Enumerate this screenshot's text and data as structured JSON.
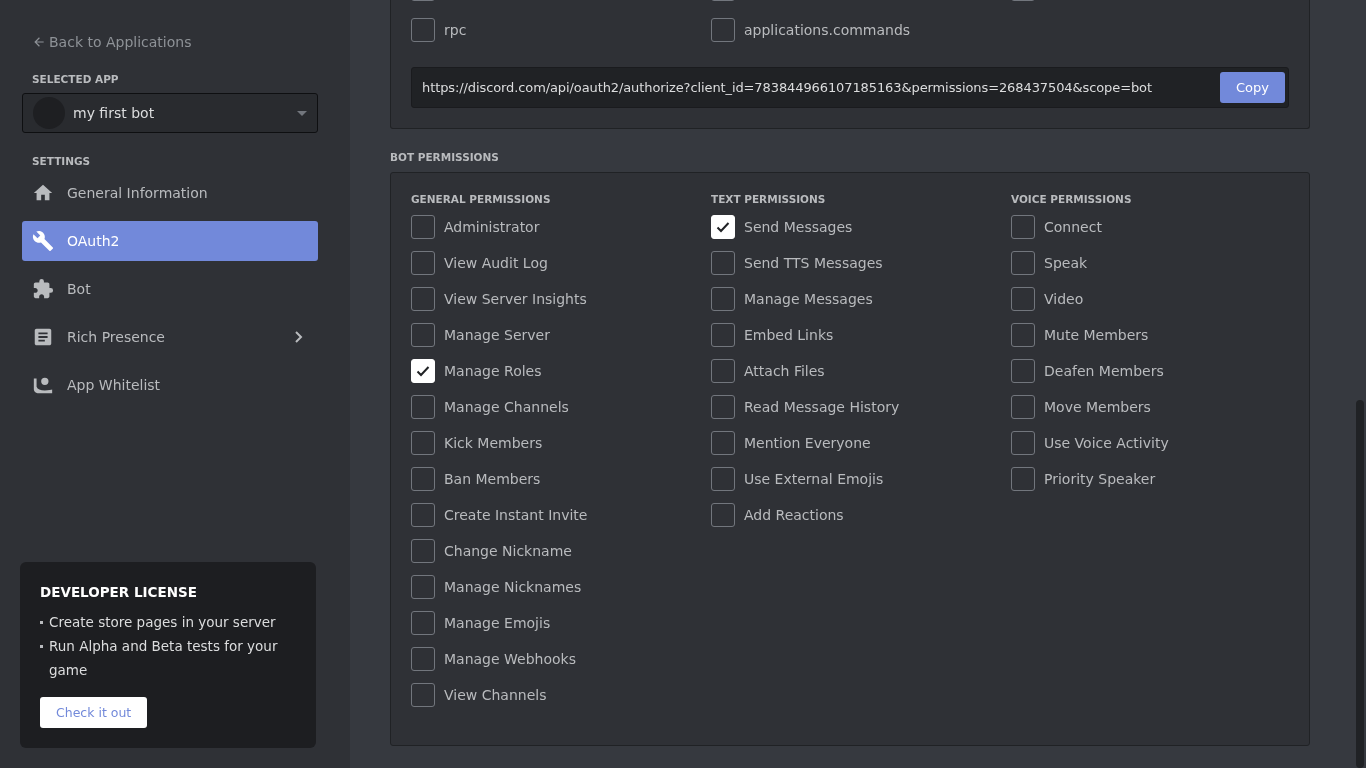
{
  "sidebar": {
    "back_link": "Back to Applications",
    "selected_app_heading": "SELECTED APP",
    "selected_app": "my first bot",
    "settings_heading": "SETTINGS",
    "items": [
      {
        "label": "General Information",
        "selected": false,
        "has_submenu": false
      },
      {
        "label": "OAuth2",
        "selected": true,
        "has_submenu": false
      },
      {
        "label": "Bot",
        "selected": false,
        "has_submenu": false
      },
      {
        "label": "Rich Presence",
        "selected": false,
        "has_submenu": true
      },
      {
        "label": "App Whitelist",
        "selected": false,
        "has_submenu": false
      }
    ],
    "license_card": {
      "title": "DEVELOPER LICENSE",
      "bullets": [
        "Create store pages in your server",
        "Run Alpha and Beta tests for your game"
      ],
      "button": "Check it out"
    }
  },
  "scopes": {
    "cut_row": [
      {
        "checked": false
      },
      {
        "checked": false
      },
      {
        "checked": false
      }
    ],
    "rows": [
      [
        {
          "label": "rpc",
          "checked": false
        },
        {
          "label": "applications.commands",
          "checked": false
        }
      ]
    ],
    "url": "https://discord.com/api/oauth2/authorize?client_id=783844966107185163&permissions=268437504&scope=bot",
    "copy_button": "Copy"
  },
  "bot_permissions": {
    "title": "BOT PERMISSIONS",
    "columns": [
      {
        "heading": "GENERAL PERMISSIONS",
        "items": [
          {
            "label": "Administrator",
            "checked": false
          },
          {
            "label": "View Audit Log",
            "checked": false
          },
          {
            "label": "View Server Insights",
            "checked": false
          },
          {
            "label": "Manage Server",
            "checked": false
          },
          {
            "label": "Manage Roles",
            "checked": true
          },
          {
            "label": "Manage Channels",
            "checked": false
          },
          {
            "label": "Kick Members",
            "checked": false
          },
          {
            "label": "Ban Members",
            "checked": false
          },
          {
            "label": "Create Instant Invite",
            "checked": false
          },
          {
            "label": "Change Nickname",
            "checked": false
          },
          {
            "label": "Manage Nicknames",
            "checked": false
          },
          {
            "label": "Manage Emojis",
            "checked": false
          },
          {
            "label": "Manage Webhooks",
            "checked": false
          },
          {
            "label": "View Channels",
            "checked": false
          }
        ]
      },
      {
        "heading": "TEXT PERMISSIONS",
        "items": [
          {
            "label": "Send Messages",
            "checked": true
          },
          {
            "label": "Send TTS Messages",
            "checked": false
          },
          {
            "label": "Manage Messages",
            "checked": false
          },
          {
            "label": "Embed Links",
            "checked": false
          },
          {
            "label": "Attach Files",
            "checked": false
          },
          {
            "label": "Read Message History",
            "checked": false
          },
          {
            "label": "Mention Everyone",
            "checked": false
          },
          {
            "label": "Use External Emojis",
            "checked": false
          },
          {
            "label": "Add Reactions",
            "checked": false
          }
        ]
      },
      {
        "heading": "VOICE PERMISSIONS",
        "items": [
          {
            "label": "Connect",
            "checked": false
          },
          {
            "label": "Speak",
            "checked": false
          },
          {
            "label": "Video",
            "checked": false
          },
          {
            "label": "Mute Members",
            "checked": false
          },
          {
            "label": "Deafen Members",
            "checked": false
          },
          {
            "label": "Move Members",
            "checked": false
          },
          {
            "label": "Use Voice Activity",
            "checked": false
          },
          {
            "label": "Priority Speaker",
            "checked": false
          }
        ]
      }
    ]
  }
}
